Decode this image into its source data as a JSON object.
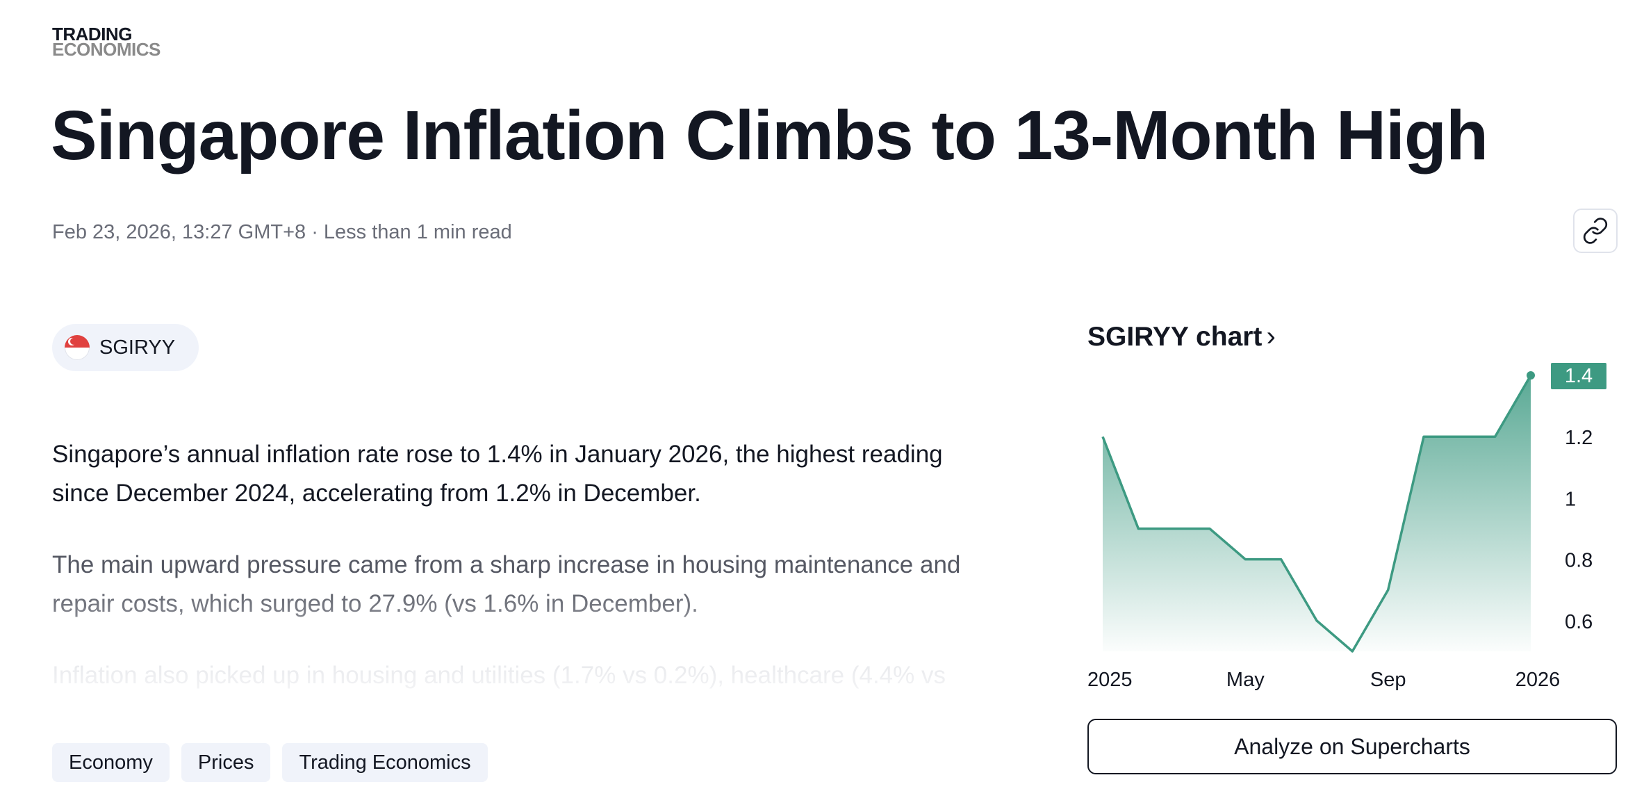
{
  "logo": {
    "line1": "TRADING",
    "line2": "ECONOMICS"
  },
  "title": "Singapore Inflation Climbs to 13-Month High",
  "meta": "Feb 23, 2026, 13:27 GMT+8 · Less than 1 min read",
  "symbol": {
    "ticker": "SGIRYY",
    "flag_icon": "singapore-flag-icon"
  },
  "article": {
    "p1": "Singapore’s annual inflation rate rose to 1.4% in January 2026, the highest reading since December 2024, accelerating from 1.2% in December.",
    "p2": "The main upward pressure came from a sharp increase in housing maintenance and repair costs, which surged to 27.9% (vs 1.6% in December).",
    "p3": "Inflation also picked up in housing and utilities (1.7% vs 0.2%), healthcare (4.4% vs"
  },
  "tags": [
    "Economy",
    "Prices",
    "Trading Economics"
  ],
  "chart_widget": {
    "title": "SGIRYY chart",
    "analyze_label": "Analyze on Supercharts",
    "link_icon": "link-icon"
  },
  "colors": {
    "accent": "#3d9a82",
    "text": "#131722",
    "muted": "#6a6d78"
  },
  "chart_data": {
    "type": "area",
    "title": "SGIRYY chart",
    "x": [
      "2025-01",
      "2025-02",
      "2025-03",
      "2025-04",
      "2025-05",
      "2025-06",
      "2025-07",
      "2025-08",
      "2025-09",
      "2025-10",
      "2025-11",
      "2025-12",
      "2026-01"
    ],
    "y": [
      1.2,
      0.9,
      0.9,
      0.9,
      0.8,
      0.8,
      0.6,
      0.5,
      0.7,
      1.2,
      1.2,
      1.2,
      1.4
    ],
    "xticks": [
      "2025",
      "May",
      "Sep",
      "2026"
    ],
    "yticks": [
      "0.6",
      "0.8",
      "1",
      "1.2"
    ],
    "last_value_label": "1.4",
    "ylim": [
      0.5,
      1.4
    ],
    "grid": false,
    "color": "#3d9a82"
  }
}
